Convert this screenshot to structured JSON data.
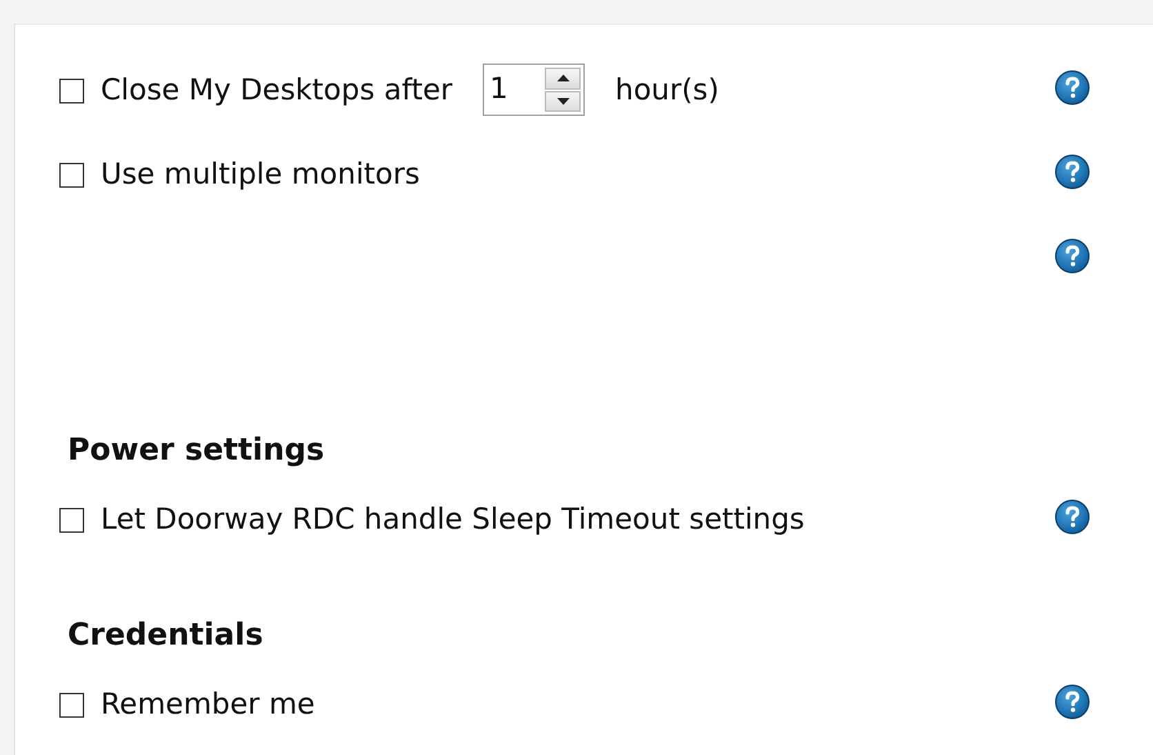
{
  "sections": [
    {
      "items": [
        {
          "kind": "duration",
          "label": "Close My Desktops after",
          "checked": false,
          "value": "1",
          "unit": "hour(s)"
        },
        {
          "kind": "checkbox",
          "label": "Use multiple monitors",
          "checked": false
        },
        {
          "kind": "help"
        }
      ]
    },
    {
      "heading": "Power settings",
      "items": [
        {
          "kind": "checkbox",
          "label": "Let Doorway RDC handle Sleep Timeout settings",
          "checked": false
        }
      ]
    },
    {
      "heading": "Credentials",
      "items": [
        {
          "kind": "checkbox",
          "label": "Remember me",
          "checked": false
        }
      ]
    }
  ]
}
